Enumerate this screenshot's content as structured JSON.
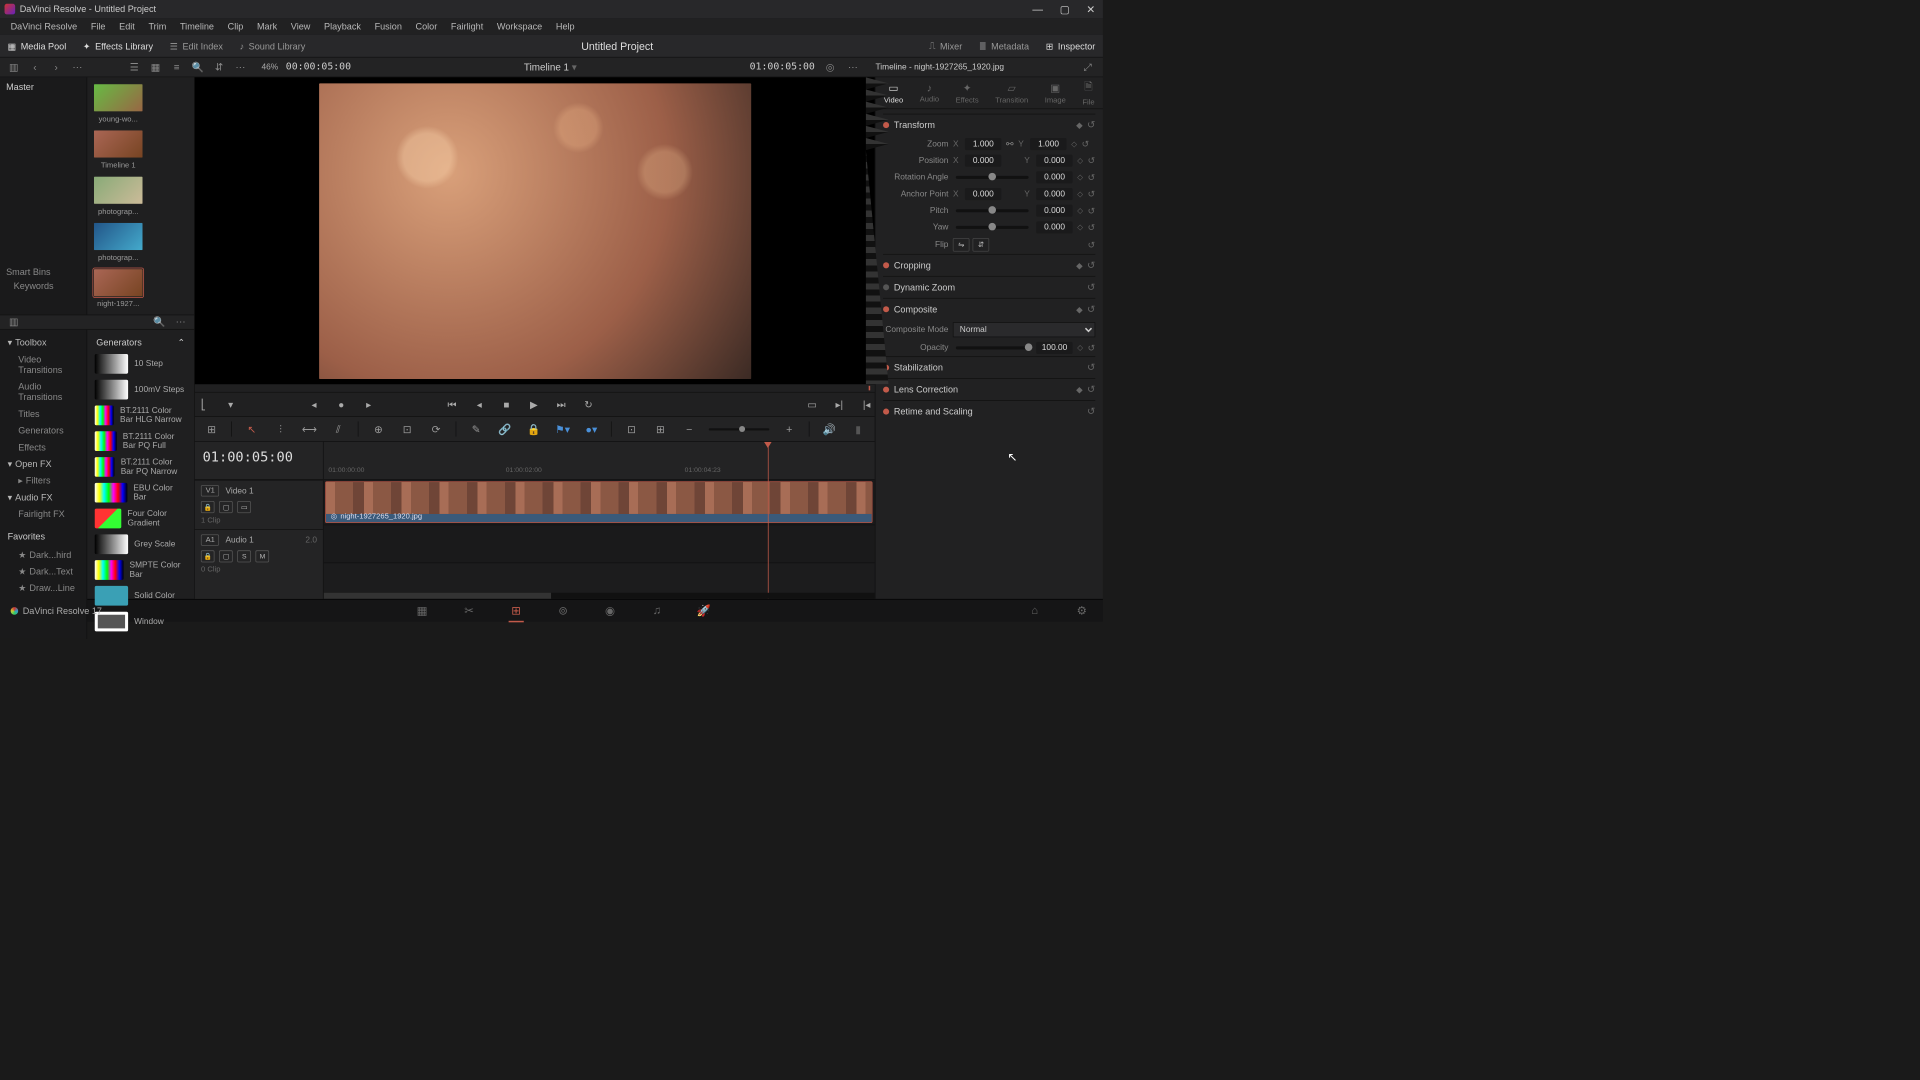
{
  "window": {
    "title": "DaVinci Resolve - Untitled Project"
  },
  "menu": [
    "DaVinci Resolve",
    "File",
    "Edit",
    "Trim",
    "Timeline",
    "Clip",
    "Mark",
    "View",
    "Playback",
    "Fusion",
    "Color",
    "Fairlight",
    "Workspace",
    "Help"
  ],
  "toolbar": {
    "media_pool": "Media Pool",
    "effects_library": "Effects Library",
    "edit_index": "Edit Index",
    "sound_library": "Sound Library",
    "project_title": "Untitled Project",
    "mixer": "Mixer",
    "metadata": "Metadata",
    "inspector": "Inspector"
  },
  "media_bar": {
    "zoom_pct": "46%",
    "source_tc": "00:00:05:00",
    "viewer_title": "Timeline 1",
    "record_tc": "01:00:05:00",
    "inspector_title": "Timeline - night-1927265_1920.jpg"
  },
  "media_pool": {
    "master": "Master",
    "smart_bins": "Smart Bins",
    "keywords": "Keywords",
    "clips": [
      {
        "name": "young-wo...",
        "t": "t1"
      },
      {
        "name": "Timeline 1",
        "t": "t2"
      },
      {
        "name": "photograp...",
        "t": "t3"
      },
      {
        "name": "photograp...",
        "t": "t4"
      },
      {
        "name": "night-1927...",
        "t": "t5",
        "selected": true
      }
    ]
  },
  "fx": {
    "toolbox": "Toolbox",
    "tree": [
      {
        "label": "Video Transitions"
      },
      {
        "label": "Audio Transitions"
      },
      {
        "label": "Titles"
      },
      {
        "label": "Generators",
        "sel": true
      },
      {
        "label": "Effects"
      }
    ],
    "openfx": "Open FX",
    "filters": "Filters",
    "audiofx": "Audio FX",
    "fairlightfx": "Fairlight FX",
    "favorites": "Favorites",
    "favs": [
      "Dark...hird",
      "Dark...Text",
      "Draw...Line"
    ],
    "gen_header": "Generators",
    "generators": [
      {
        "name": "10 Step",
        "sw": "grad"
      },
      {
        "name": "100mV Steps",
        "sw": "grad"
      },
      {
        "name": "BT.2111 Color Bar HLG Narrow",
        "sw": "bars"
      },
      {
        "name": "BT.2111 Color Bar PQ Full",
        "sw": "bars"
      },
      {
        "name": "BT.2111 Color Bar PQ Narrow",
        "sw": "bars"
      },
      {
        "name": "EBU Color Bar",
        "sw": "bars"
      },
      {
        "name": "Four Color Gradient",
        "sw": "fourcol"
      },
      {
        "name": "Grey Scale",
        "sw": "grey"
      },
      {
        "name": "SMPTE Color Bar",
        "sw": "bars"
      },
      {
        "name": "Solid Color",
        "sw": "solid"
      },
      {
        "name": "Window",
        "sw": "win"
      }
    ]
  },
  "timeline": {
    "tc": "01:00:05:00",
    "ruler": [
      "01:00:00:00",
      "01:00:02:00",
      "01:00:04:23"
    ],
    "video_track": {
      "id": "V1",
      "name": "Video 1",
      "clip_count": "1 Clip"
    },
    "audio_track": {
      "id": "A1",
      "name": "Audio 1",
      "ch": "2.0",
      "clip_count": "0 Clip"
    },
    "clip_name": "night-1927265_1920.jpg"
  },
  "inspector": {
    "tabs": [
      "Video",
      "Audio",
      "Effects",
      "Transition",
      "Image",
      "File"
    ],
    "transform": {
      "title": "Transform",
      "zoom": "Zoom",
      "zoom_x": "1.000",
      "zoom_y": "1.000",
      "position": "Position",
      "pos_x": "0.000",
      "pos_y": "0.000",
      "rotation": "Rotation Angle",
      "rot_v": "0.000",
      "anchor": "Anchor Point",
      "anch_x": "0.000",
      "anch_y": "0.000",
      "pitch": "Pitch",
      "pitch_v": "0.000",
      "yaw": "Yaw",
      "yaw_v": "0.000",
      "flip": "Flip"
    },
    "cropping": "Cropping",
    "dynamic_zoom": "Dynamic Zoom",
    "composite": {
      "title": "Composite",
      "mode_label": "Composite Mode",
      "mode": "Normal",
      "opacity_label": "Opacity",
      "opacity": "100.00"
    },
    "stabilization": "Stabilization",
    "lens": "Lens Correction",
    "retime": "Retime and Scaling"
  },
  "pagebar": {
    "version": "DaVinci Resolve 17"
  }
}
